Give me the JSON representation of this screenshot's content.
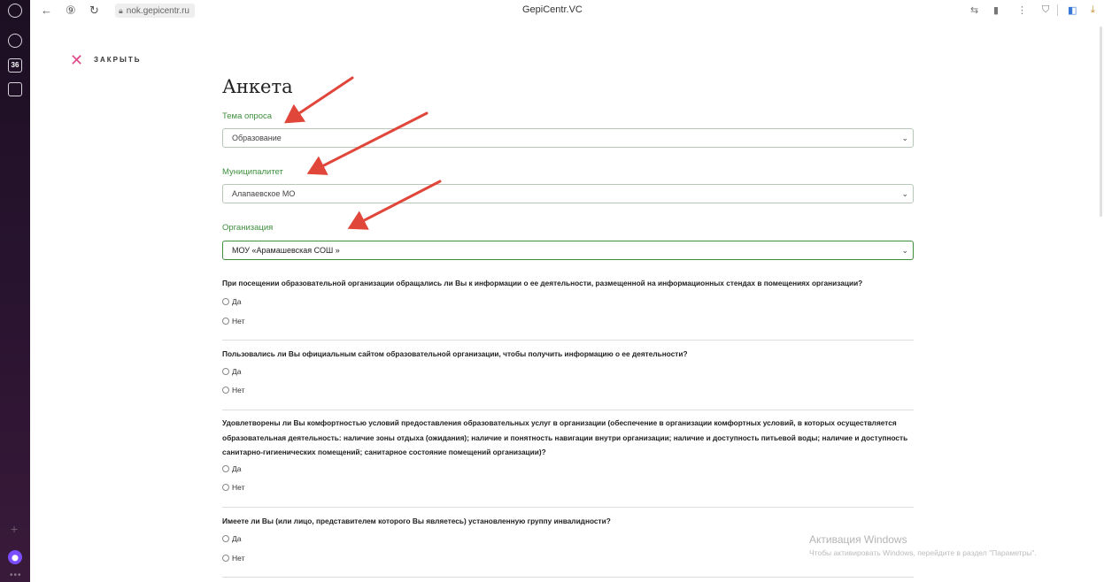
{
  "browser": {
    "url": "nok.gepicentr.ru",
    "tab_title": "GepiCentr.VC"
  },
  "close": {
    "label": "ЗАКРЫТЬ"
  },
  "form": {
    "title": "Анкета",
    "fields": [
      {
        "label": "Тема опроса",
        "value": "Образование"
      },
      {
        "label": "Муниципалитет",
        "value": "Алапаевское МО"
      },
      {
        "label": "Организация",
        "value": "МОУ «Арамашевская СОШ »"
      }
    ],
    "questions": [
      {
        "text": "При посещении образовательной организации обращались ли Вы к информации о ее деятельности, размещенной на информационных стендах в помещениях организации?",
        "options": [
          "Да",
          "Нет"
        ]
      },
      {
        "text": "Пользовались ли Вы официальным сайтом образовательной организации, чтобы получить информацию о ее деятельности?",
        "options": [
          "Да",
          "Нет"
        ]
      },
      {
        "text": "Удовлетворены ли Вы комфортностью условий предоставления образовательных услуг в организации (обеспечение в организации комфортных условий, в которых осуществляется образовательная деятельность: наличие зоны отдыха (ожидания); наличие и понятность навигации внутри организации; наличие и доступность питьевой воды; наличие и доступность санитарно-гигиенических помещений; санитарное состояние помещений организации)?",
        "options": [
          "Да",
          "Нет"
        ]
      },
      {
        "text": "Имеете ли Вы (или лицо, представителем которого Вы являетесь) установленную группу инвалидности?",
        "options": [
          "Да",
          "Нет"
        ]
      }
    ]
  },
  "watermark": {
    "title": "Активация Windows",
    "subtitle": "Чтобы активировать Windows, перейдите в раздел \"Параметры\"."
  },
  "sidebar": {
    "badge": "36"
  },
  "colors": {
    "accent_green": "#3d8f3d",
    "close_pink": "#e14a8a",
    "arrow_red": "#e0473a"
  }
}
